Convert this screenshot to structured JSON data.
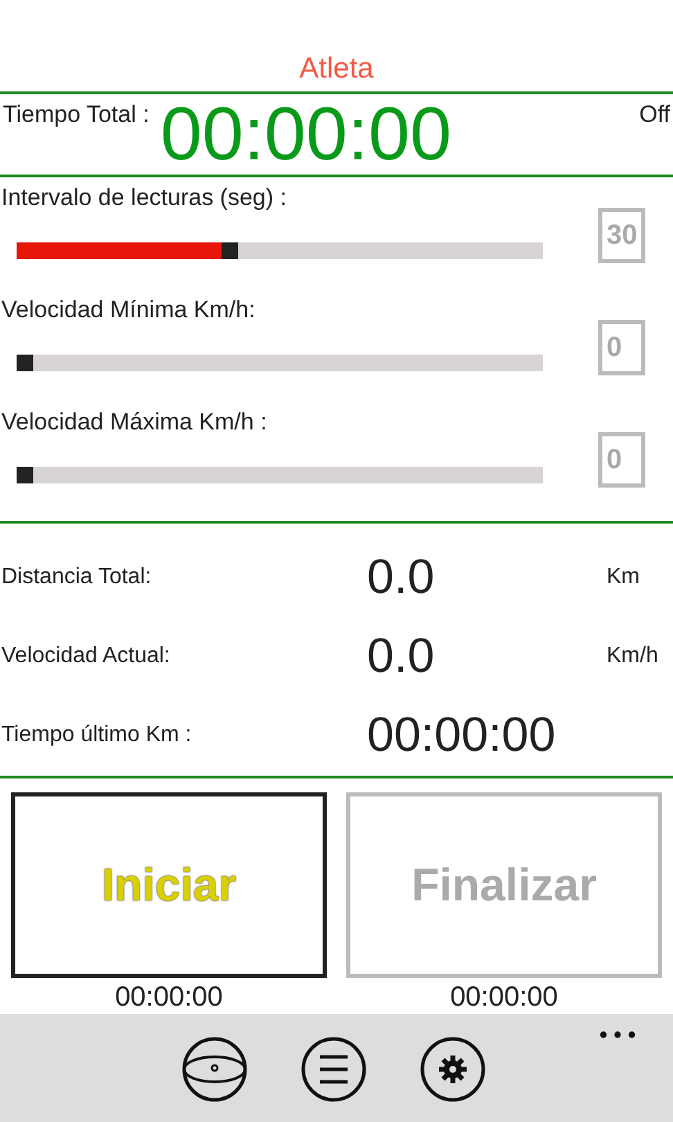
{
  "title": "Atleta",
  "timer": {
    "label": "Tiempo Total :",
    "value": "00:00:00",
    "status": "Off"
  },
  "sliders": [
    {
      "label": "Intervalo de lecturas (seg) :",
      "level": 0.39,
      "value": "30"
    },
    {
      "label": "Velocidad Mínima Km/h:",
      "level": 0,
      "value": "0"
    },
    {
      "label": "Velocidad Máxima Km/h :",
      "level": 0,
      "value": "0"
    }
  ],
  "stats": [
    {
      "label": "Distancia Total:",
      "value": "0.0",
      "unit": "Km"
    },
    {
      "label": "Velocidad Actual:",
      "value": "0.0",
      "unit": "Km/h"
    },
    {
      "label": "Tiempo último Km :",
      "value": "00:00:00"
    }
  ],
  "buttons": [
    {
      "label": "Iniciar",
      "disabled": false,
      "time": "00:00:00"
    },
    {
      "label": "Finalizar",
      "disabled": true,
      "time": "00:00:00"
    }
  ],
  "app_bar": [
    {
      "kind": "eye"
    },
    {
      "kind": "list"
    },
    {
      "kind": "settings"
    }
  ]
}
